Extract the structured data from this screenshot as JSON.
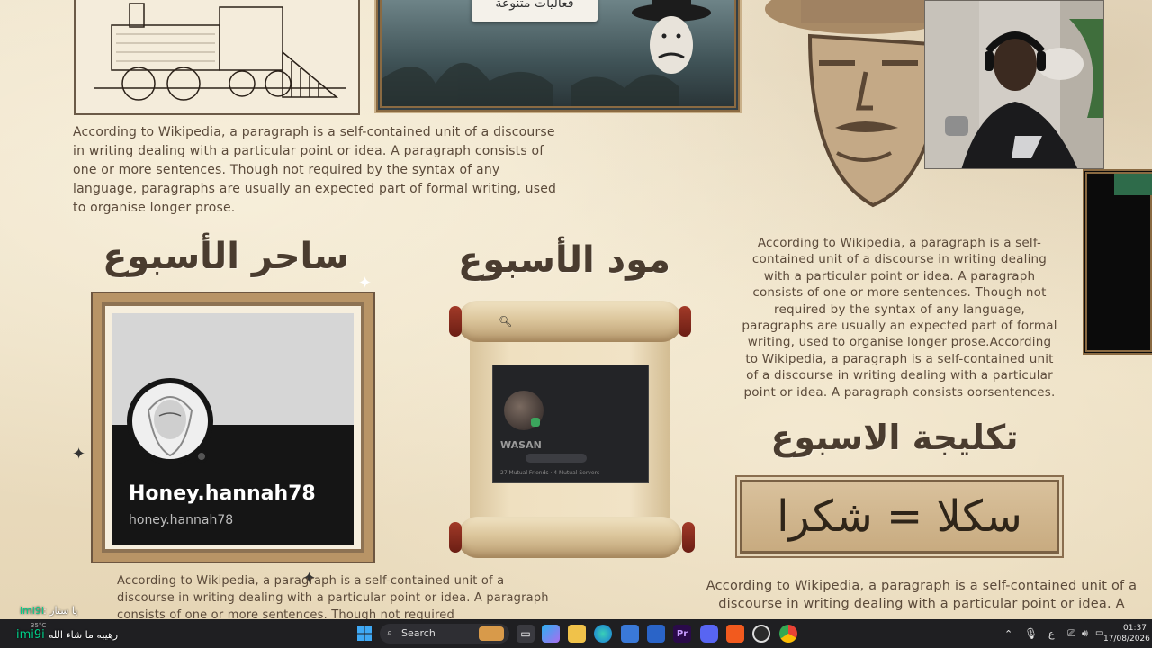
{
  "stream_overlay": {
    "banner_caption": "فعاليات متنوعة",
    "headings": {
      "wizard_of_week": "ساحر الأسبوع",
      "mod_of_week": "مود الأسبوع",
      "phrase_of_week": "تكليجة الاسبوع"
    },
    "paragraphs": {
      "top_left": "According to Wikipedia, a paragraph is a self-contained unit of a discourse in writing dealing with a particular point or idea. A paragraph consists of one or more sentences. Though not required by the syntax of any language, paragraphs are usually an expected part of formal writing, used to organise longer prose.",
      "right_center": "According to Wikipedia, a paragraph is a self-contained unit of a discourse in writing dealing with a particular point or idea. A paragraph consists of one or more sentences. Though not required by the syntax of any language, paragraphs are usually an expected part of formal writing, used to organise longer prose.According to Wikipedia, a paragraph is a self-contained unit of a discourse in writing dealing with a particular point or idea. A paragraph consists oorsentences.",
      "bottom_left": "According to Wikipedia, a paragraph is a self-contained unit of a discourse in writing dealing with a particular point or idea. A paragraph consists of one or more sentences. Though not required",
      "bottom_right": "According to Wikipedia, a paragraph is a self-contained unit of a discourse in writing dealing with a particular point or idea. A"
    },
    "wizard_card": {
      "display_name": "Honey.hannah78",
      "username": "honey.hannah78"
    },
    "mod_card": {
      "name": "WASAN",
      "meta": "27 Mutual Friends · 4 Mutual Servers"
    },
    "phrase_plaque": "سكلا = شكرا"
  },
  "chat_overlay": {
    "line1_user": "imi9i",
    "line1_text": "يا ستار :",
    "line2_user": "imi9i",
    "line2_text": "رهيبه ما شاء الله"
  },
  "taskbar": {
    "search_placeholder": "Search",
    "time": "01:37",
    "date": "17/08/2026",
    "language": "ع",
    "weather": "35°C"
  },
  "colors": {
    "parchment": "#ecdfc3",
    "heading": "#4a3c2f",
    "taskbar_bg": "#1f1f22",
    "chat_user": "#00d08a"
  }
}
